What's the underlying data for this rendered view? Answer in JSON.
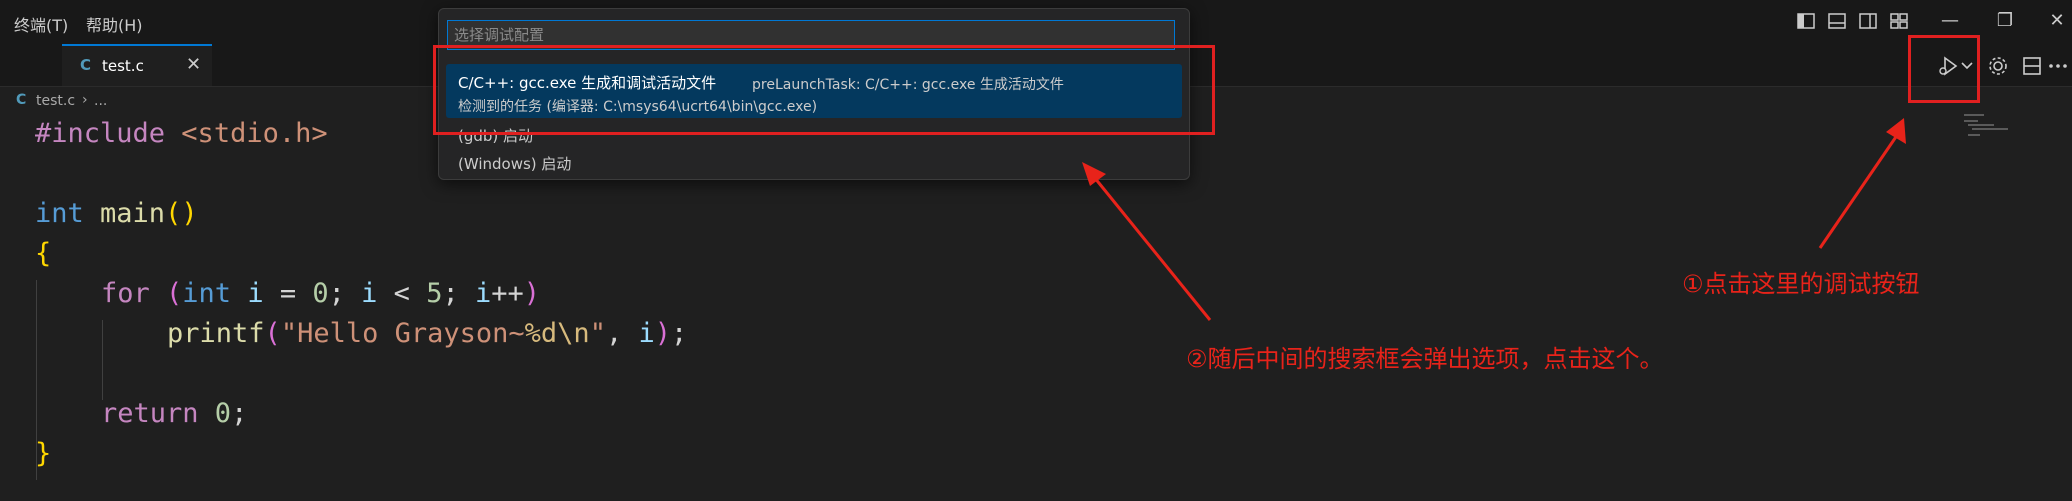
{
  "menu": {
    "terminal": "终端(T)",
    "help": "帮助(H)"
  },
  "window_controls": {
    "minimize": "—",
    "restore": "❐",
    "close": "✕"
  },
  "tab": {
    "icon": "C",
    "filename": "test.c",
    "close": "✕"
  },
  "breadcrumb": {
    "icon": "C",
    "file": "test.c",
    "separator": "›",
    "more": "..."
  },
  "code": {
    "l1_dir": "#include",
    "l1_hdr": " <stdio.h>",
    "l3_type": "int",
    "l3_fn": " main",
    "l3_paren": "()",
    "l4_brace": "{",
    "l5_for": "for",
    "l5_open": " (",
    "l5_int": "int",
    "l5_i1": " i",
    "l5_eq": " = ",
    "l5_zero": "0",
    "l5_semi1": "; ",
    "l5_i2": "i",
    "l5_lt": " < ",
    "l5_five": "5",
    "l5_semi2": "; ",
    "l5_i3": "i",
    "l5_pp": "++",
    "l5_close": ")",
    "l6_fn": "printf",
    "l6_open": "(",
    "l6_str1": "\"Hello Grayson~",
    "l6_fmt": "%d\\n",
    "l6_str2": "\"",
    "l6_comma": ", ",
    "l6_i": "i",
    "l6_close": ")",
    "l6_semi": ";",
    "l8_return": "return",
    "l8_zero": " 0",
    "l8_semi": ";",
    "l9_brace": "}"
  },
  "palette": {
    "placeholder": "选择调试配置",
    "selected": {
      "label": "C/C++: gcc.exe 生成和调试活动文件",
      "description": "preLaunchTask: C/C++: gcc.exe 生成活动文件",
      "detail": "检测到的任务 (编译器: C:\\msys64\\ucrt64\\bin\\gcc.exe)"
    },
    "options": [
      "(gdb) 启动",
      "(Windows) 启动"
    ]
  },
  "annotations": {
    "step1": "①点击这里的调试按钮",
    "step2": "②随后中间的搜索框会弹出选项，点击这个。"
  },
  "colors": {
    "annotation_red": "#e8231a",
    "accent_blue": "#0078d4",
    "selection": "#04395e"
  },
  "icons": [
    "layout-sidebar-left-icon",
    "layout-panel-icon",
    "layout-sidebar-right-icon",
    "customize-layout-icon",
    "run-debug-icon",
    "chevron-down-icon",
    "gear-icon",
    "split-editor-icon",
    "more-actions-icon"
  ]
}
